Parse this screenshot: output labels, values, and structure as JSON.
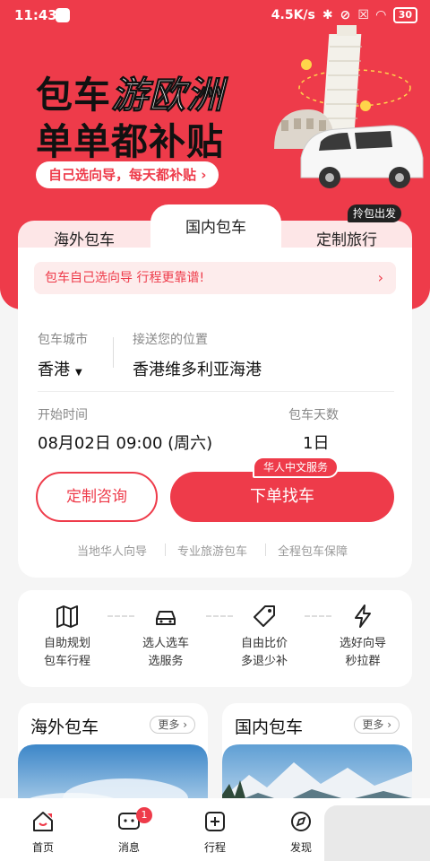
{
  "status_bar": {
    "time": "11:43",
    "net": "4.5K/s",
    "battery": "30"
  },
  "hero": {
    "title_line1_a": "包车",
    "title_line1_b": "游欧洲",
    "title_line2": "单单都补贴",
    "subtitle": "自己选向导，每天都补贴 ›"
  },
  "tabs": [
    {
      "label": "海外包车"
    },
    {
      "label": "国内包车"
    },
    {
      "label": "定制旅行"
    }
  ],
  "tab_tag": "拎包出发",
  "notice": "包车自己选向导 行程更靠谱!",
  "form": {
    "city_label": "包车城市",
    "city_value": "香港",
    "location_label": "接送您的位置",
    "location_value": "香港维多利亚海港",
    "start_label": "开始时间",
    "start_value": "08月02日 09:00 (周六)",
    "days_label": "包车天数",
    "days_value": "1日"
  },
  "buttons": {
    "consult": "定制咨询",
    "order": "下单找车",
    "order_badge": "华人中文服务"
  },
  "features": [
    "当地华人向导",
    "专业旅游包车",
    "全程包车保障"
  ],
  "services": [
    {
      "line1": "自助规划",
      "line2": "包车行程",
      "icon": "map-icon"
    },
    {
      "line1": "选人选车",
      "line2": "选服务",
      "icon": "car-icon"
    },
    {
      "line1": "自由比价",
      "line2": "多退少补",
      "icon": "tag-icon"
    },
    {
      "line1": "选好向导",
      "line2": "秒拉群",
      "icon": "lightning-icon"
    }
  ],
  "cards": [
    {
      "title": "海外包车",
      "more": "更多 ›"
    },
    {
      "title": "国内包车",
      "more": "更多 ›"
    }
  ],
  "nav": [
    {
      "label": "首页"
    },
    {
      "label": "消息",
      "badge": "1"
    },
    {
      "label": "行程"
    },
    {
      "label": "发现"
    }
  ],
  "colors": {
    "accent": "#ee3b4a",
    "tab_bg": "#fde6e7"
  }
}
